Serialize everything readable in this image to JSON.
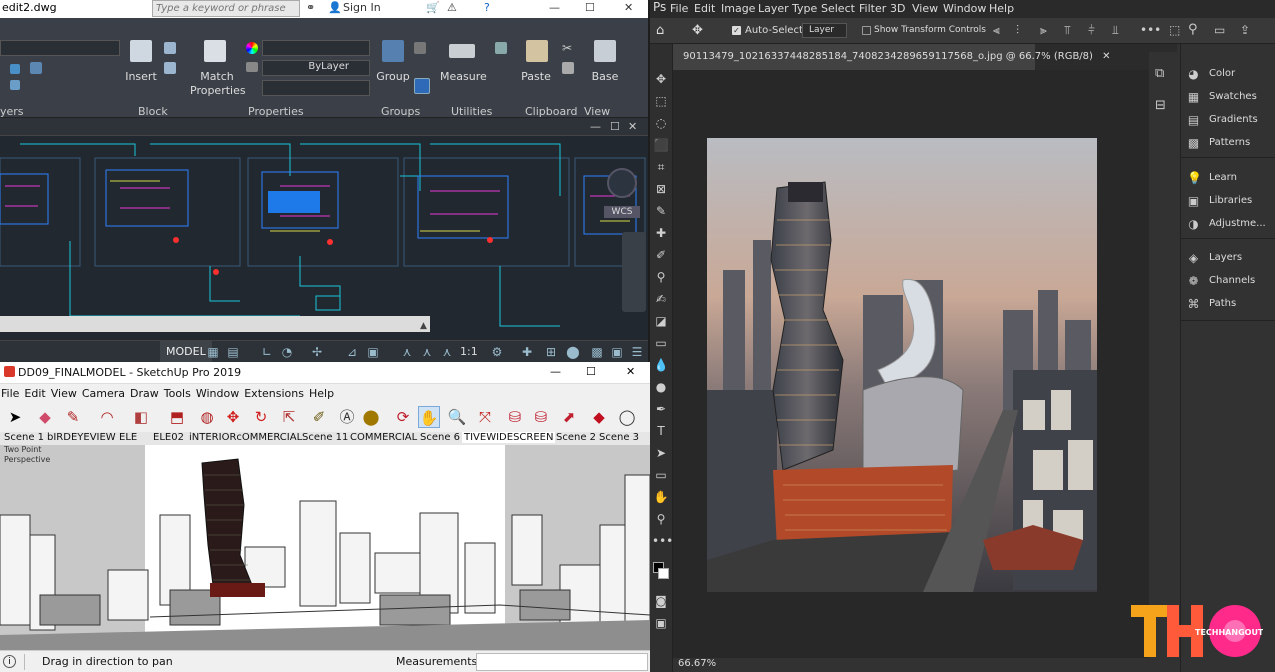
{
  "autocad": {
    "file_title": "edit2.dwg",
    "search_placeholder": "Type a keyword or phrase",
    "sign_in": "Sign In",
    "ribbon": {
      "insert": "Insert",
      "match_properties_1": "Match",
      "match_properties_2": "Properties",
      "layer_combo": "ByLayer",
      "group": "Group",
      "measure": "Measure",
      "paste": "Paste",
      "base": "Base",
      "panel_layers": "yers",
      "panel_block": "Block",
      "panel_properties": "Properties",
      "panel_groups": "Groups",
      "panel_utilities": "Utilities",
      "panel_clipboard": "Clipboard",
      "panel_view": "View"
    },
    "viewcube_label": "WCS",
    "status": {
      "model": "MODEL",
      "scale": "1:1"
    }
  },
  "sketchup": {
    "title": "DD09_FINALMODEL - SketchUp Pro 2019",
    "menu": [
      "File",
      "Edit",
      "View",
      "Camera",
      "Draw",
      "Tools",
      "Window",
      "Extensions",
      "Help"
    ],
    "scenes": [
      "Scene 1",
      "bIRDEYEVIEW",
      "ELE",
      "ELE02",
      "iNTERIORcOMMERCIAL",
      "Scene 11",
      "COMMERCIAL",
      "Scene 6",
      "TIVEWIDESCREEN",
      "Scene 2",
      "Scene 3"
    ],
    "view_label_1": "Two Point",
    "view_label_2": "Perspective",
    "status_hint": "Drag in direction to pan",
    "measurements_label": "Measurements"
  },
  "photoshop": {
    "menu": [
      "File",
      "Edit",
      "Image",
      "Layer",
      "Type",
      "Select",
      "Filter",
      "3D",
      "View",
      "Window",
      "Help"
    ],
    "options": {
      "auto_select_label": "Auto-Select:",
      "auto_select_value": "Layer",
      "transform_controls": "Show Transform Controls"
    },
    "document_tab": "90113479_10216337448285184_7408234289659117568_o.jpg @ 66.7% (RGB/8)",
    "zoom": "66.67%",
    "panels_top": [
      {
        "icon": "color-icon",
        "label": "Color"
      },
      {
        "icon": "swatches-icon",
        "label": "Swatches"
      },
      {
        "icon": "gradients-icon",
        "label": "Gradients"
      },
      {
        "icon": "patterns-icon",
        "label": "Patterns"
      }
    ],
    "panels_mid": [
      {
        "icon": "learn-icon",
        "label": "Learn"
      },
      {
        "icon": "libraries-icon",
        "label": "Libraries"
      },
      {
        "icon": "adjustments-icon",
        "label": "Adjustme..."
      }
    ],
    "panels_bot": [
      {
        "icon": "layers-icon",
        "label": "Layers"
      },
      {
        "icon": "channels-icon",
        "label": "Channels"
      },
      {
        "icon": "paths-icon",
        "label": "Paths"
      }
    ]
  },
  "watermark": {
    "brand": "TECHHANGOUT",
    "colors": {
      "orange": "#f5a31a",
      "pink": "#ff2a8a"
    }
  }
}
